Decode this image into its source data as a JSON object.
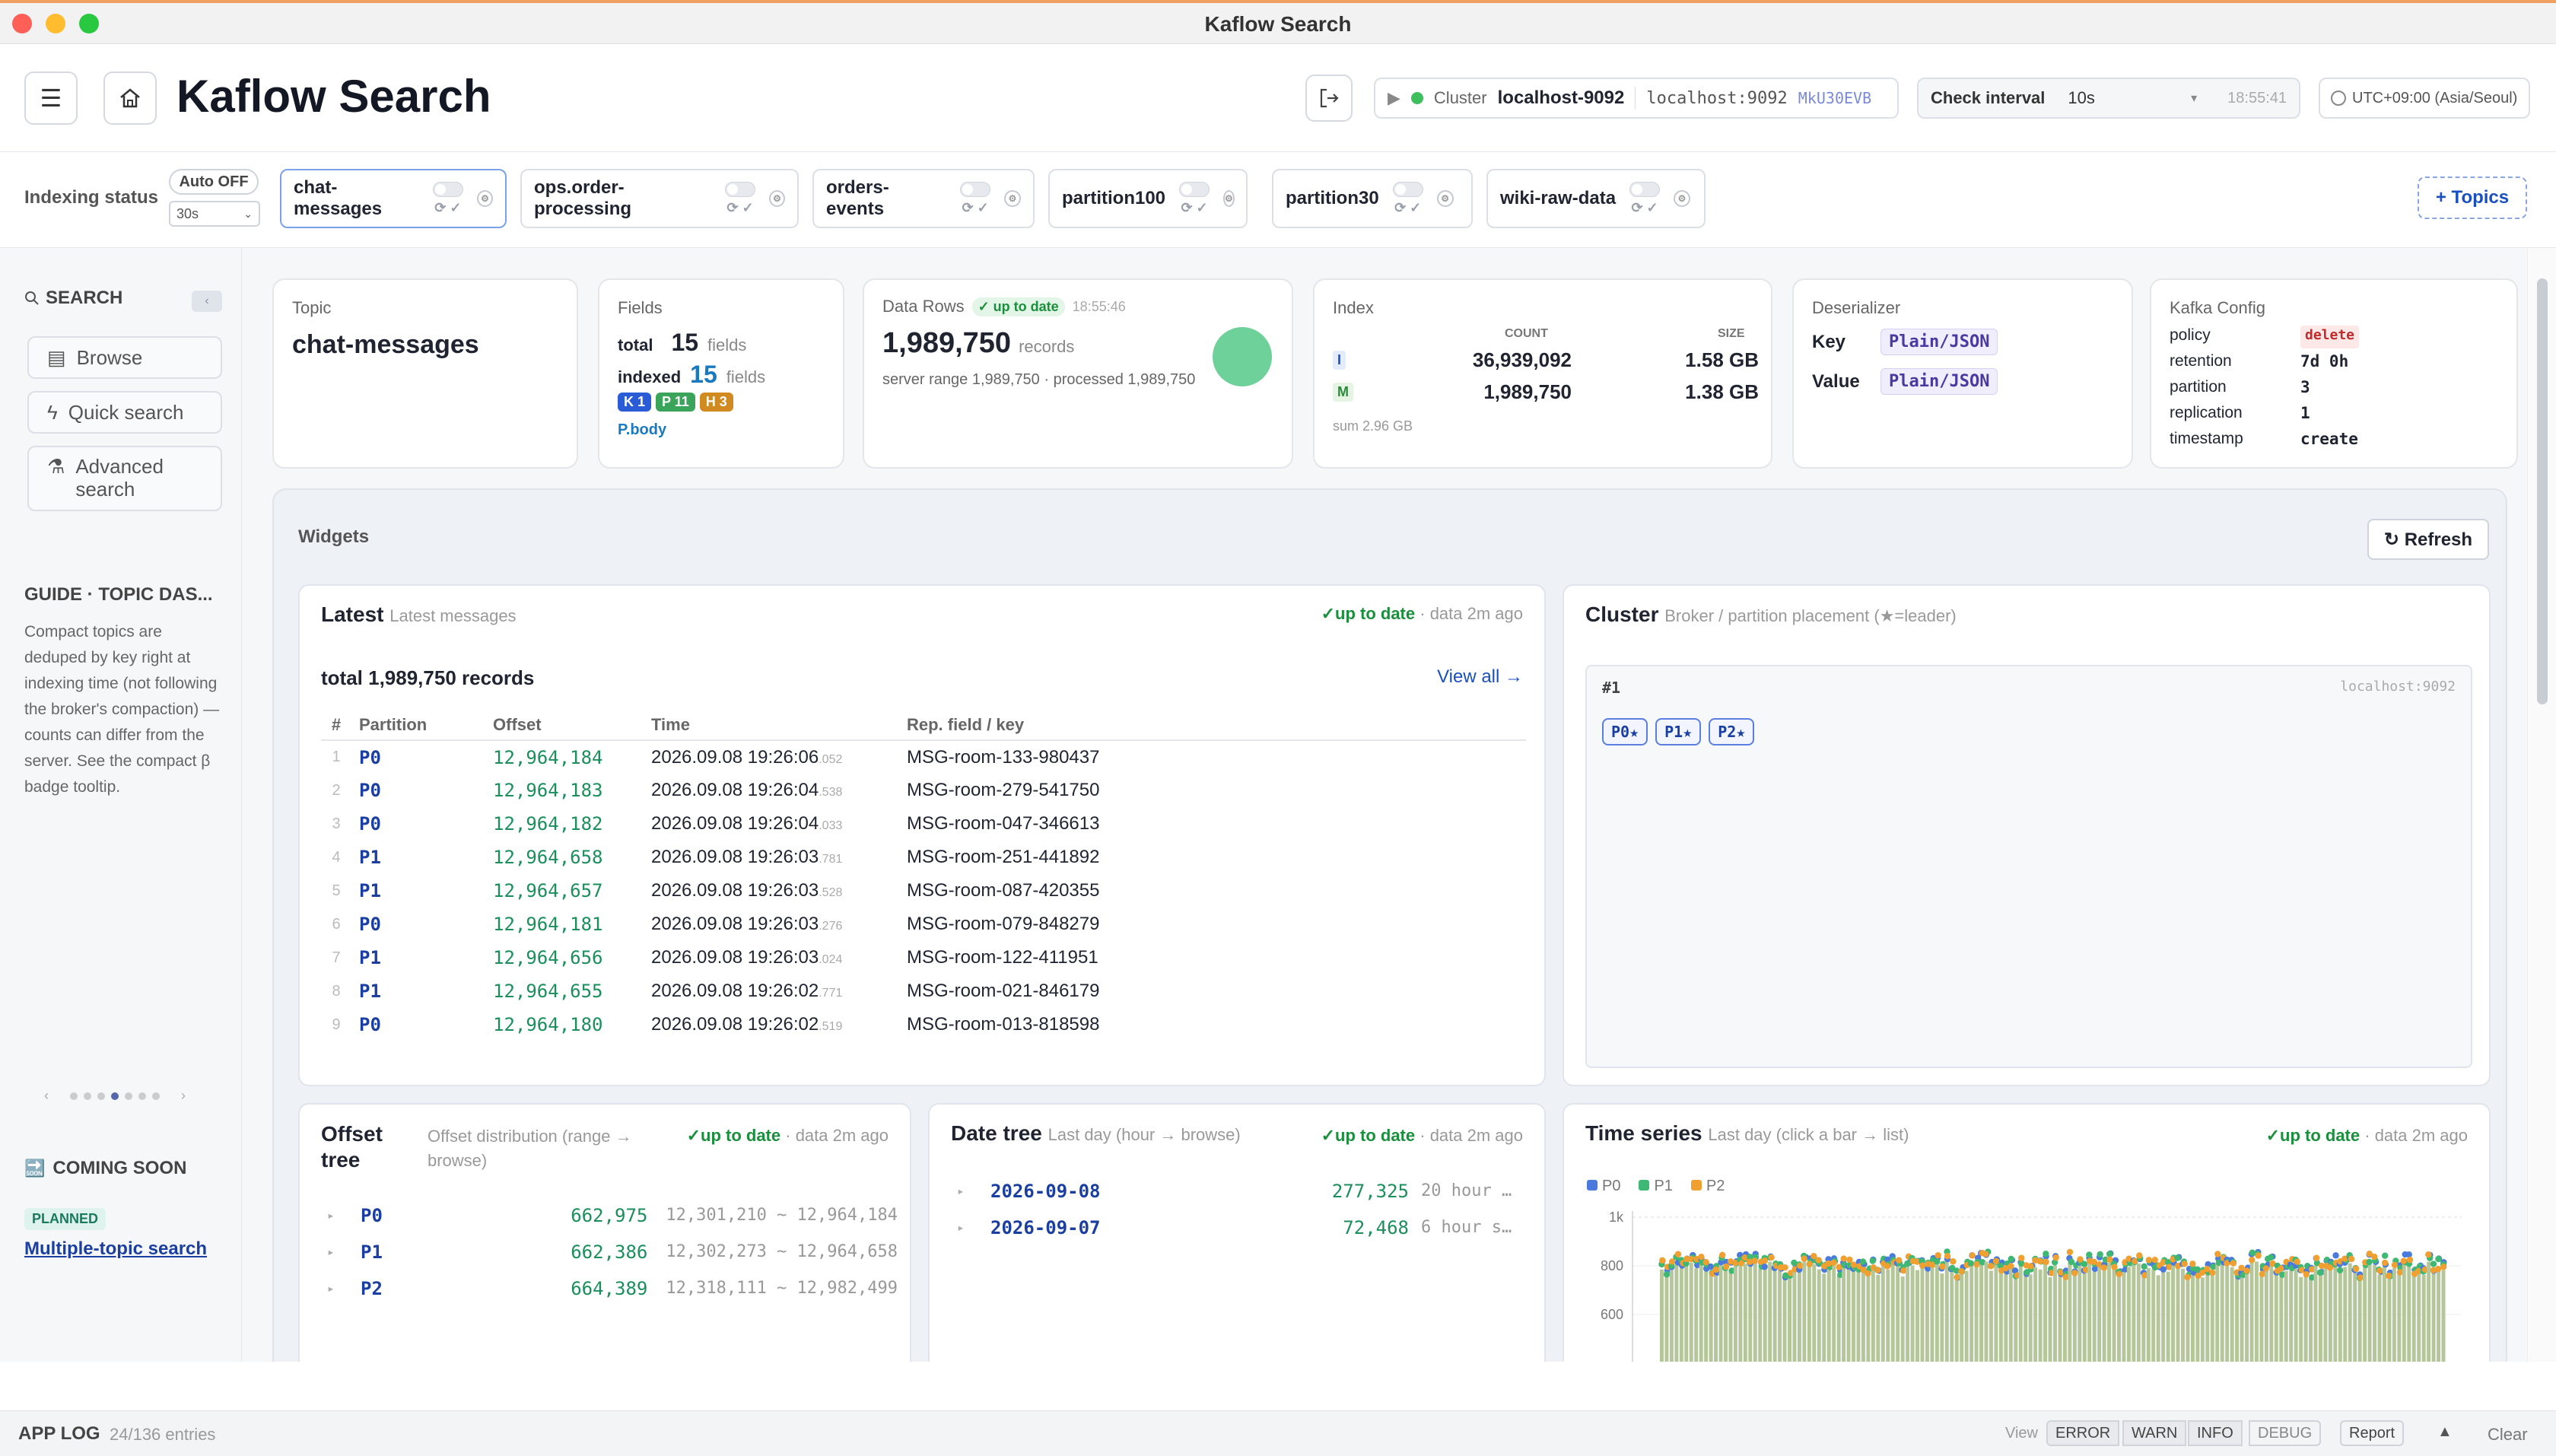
{
  "window": {
    "title": "Kaflow Search"
  },
  "header": {
    "title": "Kaflow Search",
    "cluster_label": "Cluster",
    "cluster_name": "localhost-9092",
    "cluster_host": "localhost:9092",
    "cluster_id": "MkU30EVB",
    "check_interval_label": "Check interval",
    "check_interval_value": "10s",
    "check_time": "18:55:41",
    "timezone": "UTC+09:00 (Asia/Seoul)"
  },
  "indexing": {
    "label": "Indexing status",
    "auto_label": "Auto OFF",
    "auto_interval": "30s",
    "topics": [
      "chat-messages",
      "ops.order-processing",
      "orders-events",
      "partition100",
      "partition30",
      "wiki-raw-data"
    ],
    "add_topics": "+ Topics"
  },
  "sidebar": {
    "search_title": "SEARCH",
    "items": [
      "Browse",
      "Quick search",
      "Advanced search"
    ],
    "guide_title": "GUIDE · TOPIC DAS...",
    "guide_text": "Compact topics are deduped by key right at indexing time (not following the broker's compaction) — counts can differ from the server. See the compact β badge tooltip.",
    "coming_title": "COMING SOON",
    "planned_badge": "PLANNED",
    "planned_link": "Multiple-topic search"
  },
  "cards": {
    "topic": {
      "label": "Topic",
      "value": "chat-messages"
    },
    "fields": {
      "label": "Fields",
      "total_label": "total",
      "total": "15",
      "indexed_label": "indexed",
      "indexed": "15",
      "unit": "fields",
      "badges": [
        "K 1",
        "P 11",
        "H 3"
      ],
      "extra": "P.body"
    },
    "datarows": {
      "label": "Data Rows",
      "status": "✓ up to date",
      "time": "18:55:46",
      "count": "1,989,750",
      "unit": "records",
      "range": "server range 1,989,750 · processed 1,989,750"
    },
    "index": {
      "label": "Index",
      "col_count": "COUNT",
      "col_size": "SIZE",
      "rows": [
        {
          "tag": "I",
          "count": "36,939,092",
          "size": "1.58 GB"
        },
        {
          "tag": "M",
          "count": "1,989,750",
          "size": "1.38 GB"
        }
      ],
      "sum": "sum 2.96 GB"
    },
    "deserializer": {
      "label": "Deserializer",
      "key_label": "Key",
      "key": "Plain/JSON",
      "value_label": "Value",
      "value": "Plain/JSON"
    },
    "kafka": {
      "label": "Kafka Config",
      "rows": [
        {
          "k": "policy",
          "v": "delete"
        },
        {
          "k": "retention",
          "v": "7d 0h"
        },
        {
          "k": "partition",
          "v": "3"
        },
        {
          "k": "replication",
          "v": "1"
        },
        {
          "k": "timestamp",
          "v": "create"
        }
      ]
    }
  },
  "widgets": {
    "title": "Widgets",
    "refresh": "↻ Refresh",
    "latest": {
      "title": "Latest",
      "subtitle": "Latest messages",
      "status": "✓up to date",
      "age": "· data 2m ago",
      "total": "total 1,989,750 records",
      "view_all": "View all →",
      "columns": [
        "#",
        "Partition",
        "Offset",
        "Time",
        "Rep. field / key"
      ],
      "rows": [
        [
          "1",
          "P0",
          "12,964,184",
          "2026.09.08 19:26:06",
          ".052",
          "MSG-room-133-980437"
        ],
        [
          "2",
          "P0",
          "12,964,183",
          "2026.09.08 19:26:04",
          ".538",
          "MSG-room-279-541750"
        ],
        [
          "3",
          "P0",
          "12,964,182",
          "2026.09.08 19:26:04",
          ".033",
          "MSG-room-047-346613"
        ],
        [
          "4",
          "P1",
          "12,964,658",
          "2026.09.08 19:26:03",
          ".781",
          "MSG-room-251-441892"
        ],
        [
          "5",
          "P1",
          "12,964,657",
          "2026.09.08 19:26:03",
          ".528",
          "MSG-room-087-420355"
        ],
        [
          "6",
          "P0",
          "12,964,181",
          "2026.09.08 19:26:03",
          ".276",
          "MSG-room-079-848279"
        ],
        [
          "7",
          "P1",
          "12,964,656",
          "2026.09.08 19:26:03",
          ".024",
          "MSG-room-122-411951"
        ],
        [
          "8",
          "P1",
          "12,964,655",
          "2026.09.08 19:26:02",
          ".771",
          "MSG-room-021-846179"
        ],
        [
          "9",
          "P0",
          "12,964,180",
          "2026.09.08 19:26:02",
          ".519",
          "MSG-room-013-818598"
        ]
      ]
    },
    "cluster": {
      "title": "Cluster",
      "subtitle": "Broker / partition placement (★=leader)",
      "broker": "#1",
      "host": "localhost:9092",
      "partitions": [
        "P0★",
        "P1★",
        "P2★"
      ]
    },
    "offset_tree": {
      "title": "Offset tree",
      "subtitle": "Offset distribution (range → browse)",
      "status": "✓up to date",
      "age": "· data 2m ago",
      "rows": [
        {
          "p": "P0",
          "count": "662,975",
          "range": "12,301,210 ~ 12,964,184"
        },
        {
          "p": "P1",
          "count": "662,386",
          "range": "12,302,273 ~ 12,964,658"
        },
        {
          "p": "P2",
          "count": "664,389",
          "range": "12,318,111 ~ 12,982,499"
        }
      ]
    },
    "date_tree": {
      "title": "Date tree",
      "subtitle": "Last day (hour → browse)",
      "status": "✓up to date",
      "age": "· data 2m ago",
      "rows": [
        {
          "d": "2026-09-08",
          "count": "277,325",
          "note": "20 hour …"
        },
        {
          "d": "2026-09-07",
          "count": "72,468",
          "note": "6 hour s…"
        }
      ]
    },
    "time_series": {
      "title": "Time series",
      "subtitle": "Last day (click a bar → list)",
      "status": "✓up to date",
      "age": "· data 2m ago"
    }
  },
  "chart_data": {
    "type": "bar",
    "series": [
      {
        "name": "P0"
      },
      {
        "name": "P1"
      },
      {
        "name": "P2"
      }
    ],
    "y_ticks": [
      "1k",
      "800",
      "600"
    ],
    "colors": {
      "P0": "#4a7bdc",
      "P1": "#3fb873",
      "P2": "#f0a030"
    }
  },
  "applog": {
    "title": "APP LOG",
    "entries": "24/136 entries",
    "view_label": "View",
    "levels": [
      "ERROR",
      "WARN",
      "INFO",
      "DEBUG"
    ],
    "report": "Report",
    "toggle": "▲",
    "clear": "Clear"
  }
}
